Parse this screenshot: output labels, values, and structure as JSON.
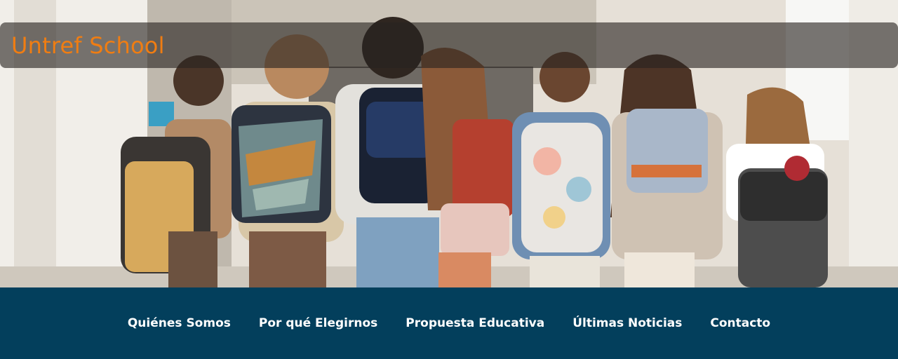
{
  "site": {
    "title": "Untref School",
    "brand_color": "#f07d12"
  },
  "hero": {
    "image_subject": "children-with-backpacks-in-school-hallway"
  },
  "nav": {
    "background": "#033f5c",
    "items": [
      {
        "label": "Quiénes Somos"
      },
      {
        "label": "Por qué Elegirnos"
      },
      {
        "label": "Propuesta Educativa"
      },
      {
        "label": "Últimas Noticias"
      },
      {
        "label": "Contacto"
      }
    ]
  }
}
